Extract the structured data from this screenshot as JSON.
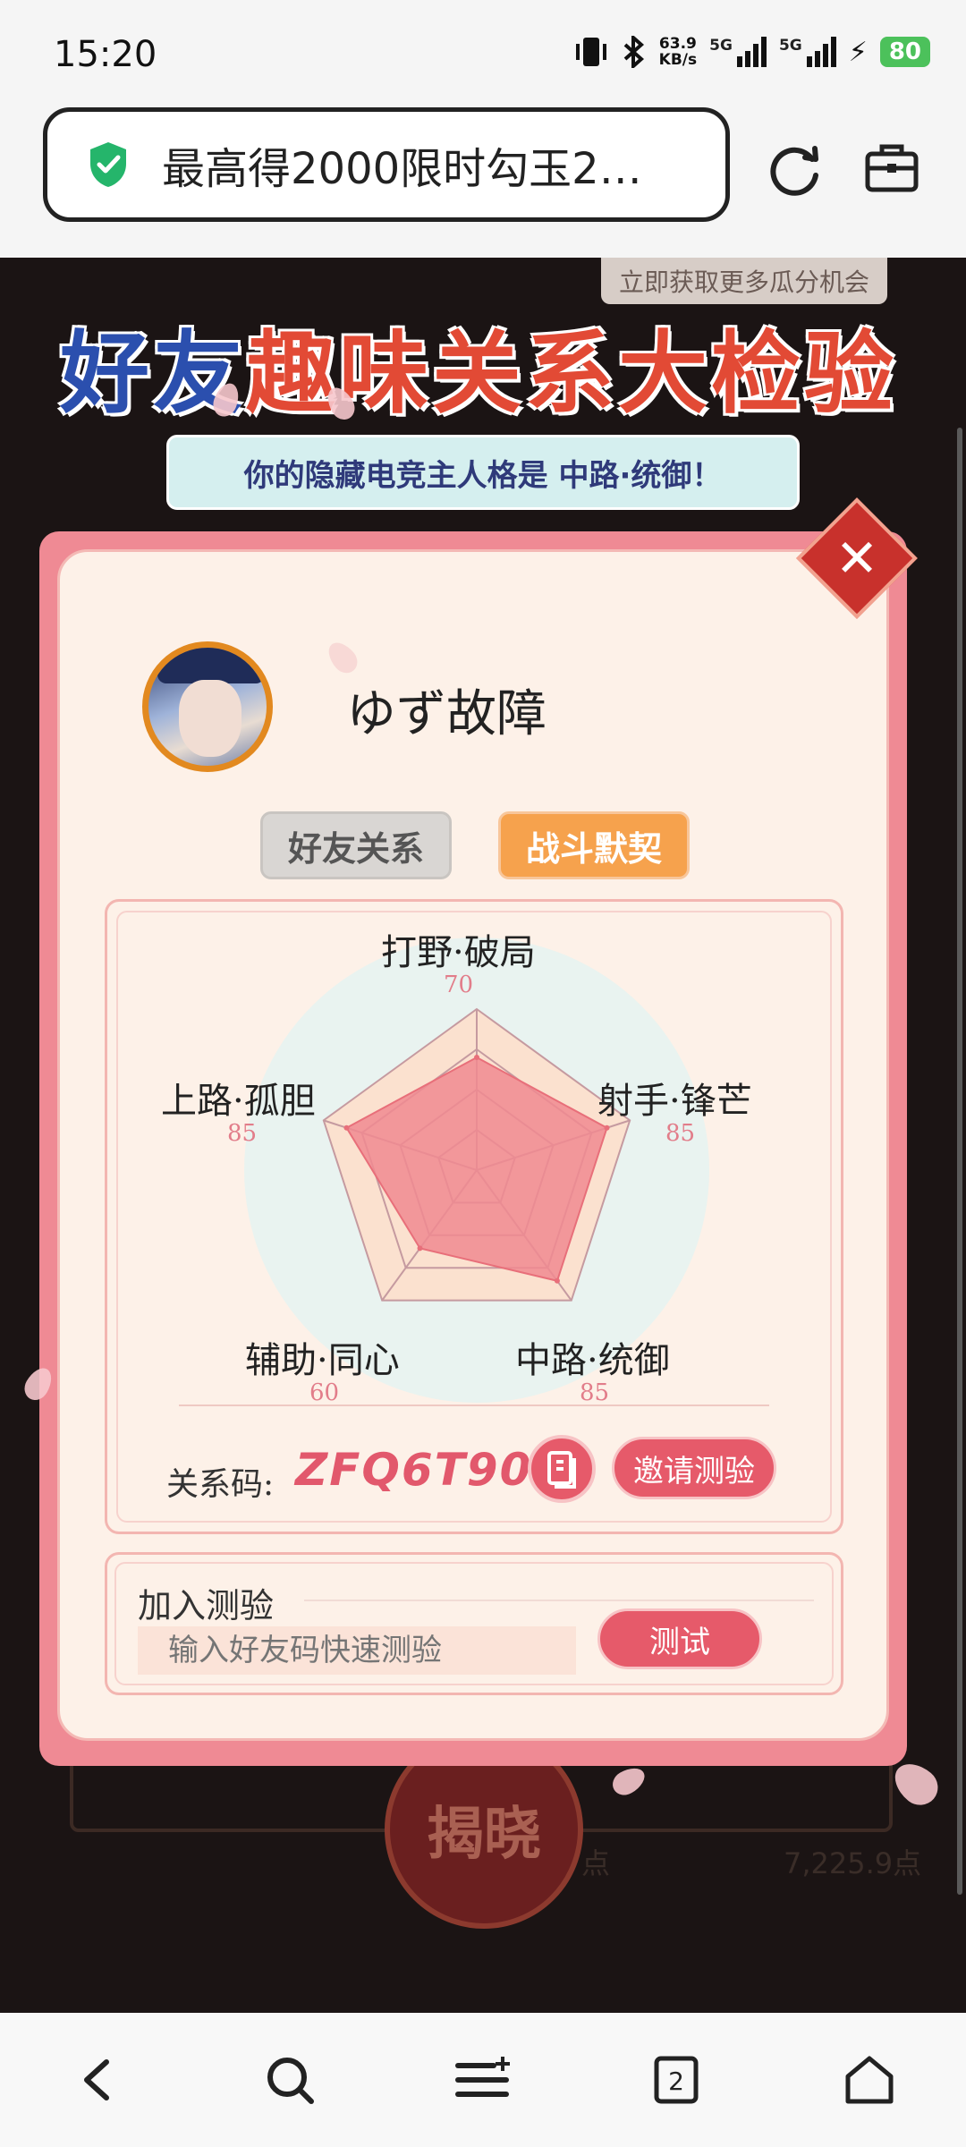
{
  "status_bar": {
    "time": "15:20",
    "net_speed_value": "63.9",
    "net_speed_unit": "KB/s",
    "sim1": "5G",
    "sim2": "5G",
    "battery": "80"
  },
  "browser": {
    "url_title": "最高得2000限时勾玉2…",
    "icons": [
      "shield-check-icon",
      "reload-icon",
      "toolbox-icon"
    ]
  },
  "page": {
    "top_chip": "立即获取更多瓜分机会",
    "title_part1": "好友",
    "title_part2": "趣味关系",
    "title_part3": "大检验",
    "subtitle": "你的隐藏电竞主人格是 中路·统御！",
    "username": "ゆず故障",
    "tabs": [
      {
        "label": "好友关系",
        "active": false
      },
      {
        "label": "战斗默契",
        "active": true
      }
    ],
    "code_label": "关系码:",
    "code_value": "ZFQ6T90N",
    "invite_label": "邀请测验",
    "join_title": "加入测验",
    "join_placeholder": "输入好友码快速测验",
    "test_label": "测试",
    "reveal_label": "揭晓",
    "bg_text_a": "点",
    "bg_text_b": "7,225.9点"
  },
  "chart_data": {
    "type": "radar",
    "axes": [
      "打野·破局",
      "射手·锋芒",
      "中路·统御",
      "辅助·同心",
      "上路·孤胆"
    ],
    "values": [
      70,
      85,
      85,
      60,
      85
    ],
    "max": 100,
    "colors": {
      "fill": "#f08a90",
      "outer": "#fbe1cf",
      "grid": "#c59aa0"
    }
  },
  "bottom_nav": {
    "icons": [
      "back-icon",
      "search-icon",
      "menu-icon",
      "tabs-icon",
      "home-icon"
    ],
    "tab_count": "2"
  }
}
